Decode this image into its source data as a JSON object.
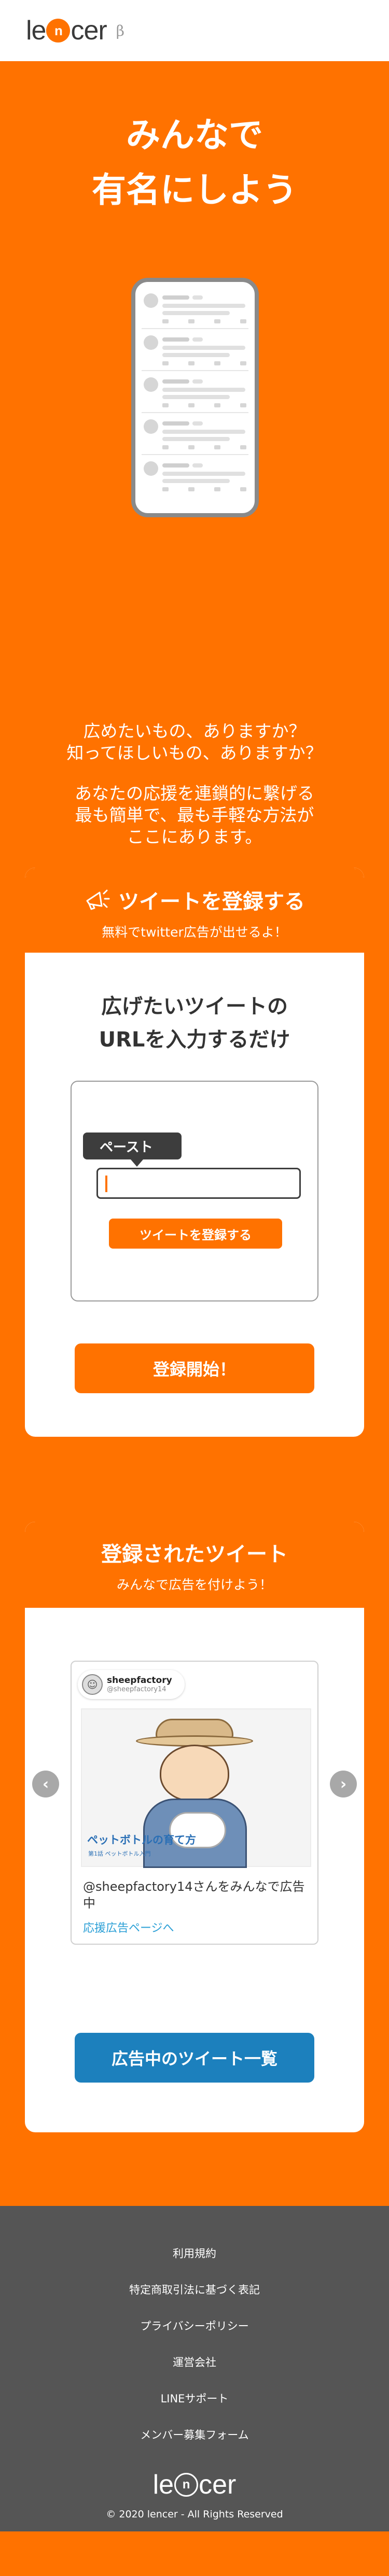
{
  "header": {
    "logo_left": "le",
    "logo_mark": "n",
    "logo_right": "cer",
    "beta": "β"
  },
  "hero": {
    "title_line1": "みんなで",
    "title_line2": "有名にしよう",
    "sub1_line1": "広めたいもの、ありますか？",
    "sub1_line2": "知ってほしいもの、ありますか？",
    "sub2_line1": "あなたの応援を連鎖的に繋げる",
    "sub2_line2": "最も簡単で、最も手軽な方法が",
    "sub2_line3": "ここにあります。"
  },
  "register_card": {
    "title": "ツイートを登録する",
    "subtitle": "無料でtwitter広告が出せるよ！",
    "lead_line1": "広げたいツイートの",
    "lead_line2": "URLを入力するだけ",
    "paste_label": "ペースト",
    "mini_button": "ツイートを登録する",
    "start_button": "登録開始！"
  },
  "tweets_card": {
    "title": "登録されたツイート",
    "subtitle": "みんなで広告を付けよう！",
    "account_name": "sheepfactory",
    "account_handle": "@sheepfactory14",
    "image_caption": "ペットボトルの育て方",
    "image_caption_small": "第1話 ペットボトル入門",
    "tweet_text": "@sheepfactory14さんをみんなで広告中",
    "tweet_link": "応援広告ページへ",
    "prev_arrow": "‹",
    "next_arrow": "›",
    "list_button": "広告中のツイート一覧"
  },
  "footer": {
    "links": [
      "利用規約",
      "特定商取引法に基づく表記",
      "プライバシーポリシー",
      "運営会社",
      "LINEサポート",
      "メンバー募集フォーム"
    ],
    "logo_left": "le",
    "logo_mark": "n",
    "logo_right": "cer",
    "copyright": "© 2020 lencer - All Rights Reserved"
  },
  "colors": {
    "accent": "#ff7200",
    "footer_bg": "#555555",
    "list_button": "#1c80bd"
  }
}
